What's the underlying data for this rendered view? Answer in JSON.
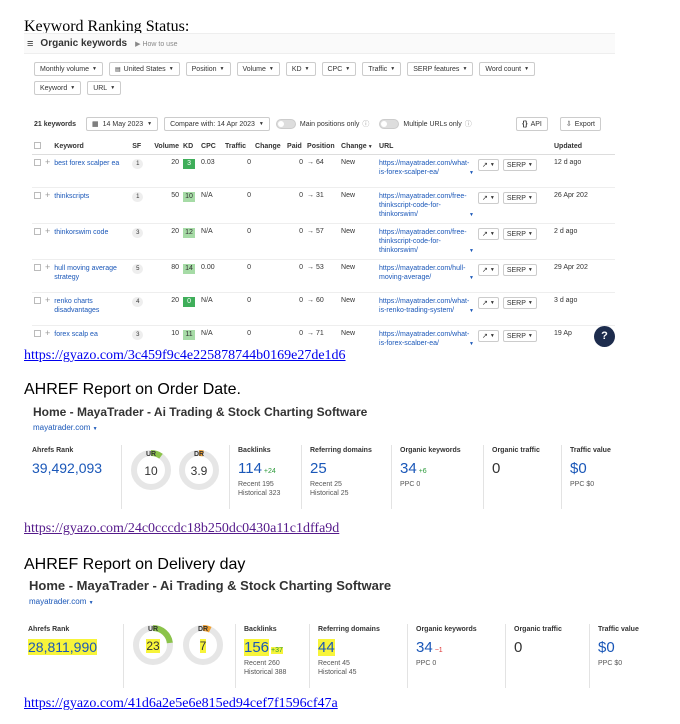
{
  "heading1": "Keyword Ranking Status:",
  "kw_panel": {
    "menu_icon": "hamburger-icon",
    "title": "Organic keywords",
    "howto": "How to use",
    "filters": [
      {
        "label": "Monthly volume",
        "icon": ""
      },
      {
        "label": "United States",
        "icon": "us-flag"
      },
      {
        "label": "Position",
        "icon": ""
      },
      {
        "label": "Volume",
        "icon": ""
      },
      {
        "label": "KD",
        "icon": ""
      },
      {
        "label": "CPC",
        "icon": ""
      },
      {
        "label": "Traffic",
        "icon": ""
      },
      {
        "label": "SERP features",
        "icon": ""
      },
      {
        "label": "Word count",
        "icon": ""
      },
      {
        "label": "Keyword",
        "icon": ""
      },
      {
        "label": "URL",
        "icon": ""
      }
    ],
    "toolbar": {
      "count": "21 keywords",
      "date": "14 May 2023",
      "compare": "Compare with: 14 Apr 2023",
      "main_positions": "Main positions only",
      "multiple_urls": "Multiple URLs only",
      "api": "API",
      "export": "Export"
    },
    "columns": [
      "Keyword",
      "SF",
      "Volume",
      "KD",
      "CPC",
      "Traffic",
      "Change",
      "Paid",
      "Position",
      "Change",
      "URL",
      "",
      "Updated"
    ],
    "rows": [
      {
        "keyword": "best forex scalper ea",
        "sf": "1",
        "volume": "20",
        "kd": "3",
        "kd_color": "#3fae5a",
        "cpc": "0.03",
        "traffic": "0",
        "paid": "0",
        "position": "→ 64",
        "change": "New",
        "url": "https://mayatrader.com/what-is-forex-scalper-ea/",
        "serp": "SERP",
        "updated": "12 d ago"
      },
      {
        "keyword": "thinkscripts",
        "sf": "1",
        "volume": "50",
        "kd": "10",
        "kd_color": "#a6dba6",
        "cpc": "N/A",
        "traffic": "0",
        "paid": "0",
        "position": "→ 31",
        "change": "New",
        "url": "https://mayatrader.com/free-thinkscript-code-for-thinkorswim/",
        "serp": "SERP",
        "updated": "26 Apr 202"
      },
      {
        "keyword": "thinkorswim code",
        "sf": "3",
        "volume": "20",
        "kd": "12",
        "kd_color": "#a6dba6",
        "cpc": "N/A",
        "traffic": "0",
        "paid": "0",
        "position": "→ 57",
        "change": "New",
        "url": "https://mayatrader.com/free-thinkscript-code-for-thinkorswim/",
        "serp": "SERP",
        "updated": "2 d ago"
      },
      {
        "keyword": "hull moving average strategy",
        "sf": "5",
        "volume": "80",
        "kd": "14",
        "kd_color": "#a6dba6",
        "cpc": "0.00",
        "traffic": "0",
        "paid": "0",
        "position": "→ 53",
        "change": "New",
        "url": "https://mayatrader.com/hull-moving-average/",
        "serp": "SERP",
        "updated": "29 Apr 202"
      },
      {
        "keyword": "renko charts disadvantages",
        "sf": "4",
        "volume": "20",
        "kd": "0",
        "kd_color": "#3fae5a",
        "cpc": "N/A",
        "traffic": "0",
        "paid": "0",
        "position": "→ 60",
        "change": "New",
        "url": "https://mayatrader.com/what-is-renko-trading-system/",
        "serp": "SERP",
        "updated": "3 d ago"
      },
      {
        "keyword": "forex scalp ea",
        "sf": "3",
        "volume": "10",
        "kd": "11",
        "kd_color": "#a6dba6",
        "cpc": "N/A",
        "traffic": "0",
        "paid": "0",
        "position": "→ 71",
        "change": "New",
        "url": "https://mayatrader.com/what-is-forex-scalper-ea/",
        "serp": "SERP",
        "updated": "19 Ap"
      }
    ],
    "help": "?"
  },
  "link1": "https://gyazo.com/3c459f9c4e225878744b0169e27de1d6",
  "heading2": "AHREF Report on Order Date.",
  "report1": {
    "title": "Home - MayaTrader - Ai Trading & Stock Charting Software",
    "domain": "mayatrader.com",
    "ahrefs_rank_label": "Ahrefs Rank",
    "ahrefs_rank": "39,492,093",
    "ur_label": "UR",
    "ur": "10",
    "ur_level": 0.1,
    "dr_label": "DR",
    "dr": "3.9",
    "dr_level": 0.04,
    "backlinks_label": "Backlinks",
    "backlinks": "114",
    "backlinks_delta": "+24",
    "backlinks_recent": "Recent 195",
    "backlinks_hist": "Historical 323",
    "refdom_label": "Referring domains",
    "refdom": "25",
    "refdom_recent": "Recent 25",
    "refdom_hist": "Historical 25",
    "organic_kw_label": "Organic keywords",
    "organic_kw": "34",
    "organic_kw_delta": "+6",
    "ppc_kw": "PPC 0",
    "organic_traffic_label": "Organic traffic",
    "organic_traffic": "0",
    "traffic_value_label": "Traffic value",
    "traffic_value": "$0",
    "ppc_value": "PPC $0"
  },
  "link2": "https://gyazo.com/24c0cccdc18b250dc0430a11c1dffa9d",
  "heading3": "AHREF Report on Delivery day",
  "report2": {
    "title": "Home - MayaTrader - Ai Trading & Stock Charting Software",
    "domain": "mayatrader.com",
    "ahrefs_rank_label": "Ahrefs Rank",
    "ahrefs_rank": "28,811,990",
    "ur_label": "UR",
    "ur": "23",
    "ur_level": 0.23,
    "dr_label": "DR",
    "dr": "7",
    "dr_level": 0.07,
    "backlinks_label": "Backlinks",
    "backlinks": "156",
    "backlinks_delta": "+37",
    "backlinks_recent": "Recent 260",
    "backlinks_hist": "Historical 388",
    "refdom_label": "Referring domains",
    "refdom": "44",
    "refdom_recent": "Recent 45",
    "refdom_hist": "Historical 45",
    "organic_kw_label": "Organic keywords",
    "organic_kw": "34",
    "organic_kw_delta": "−1",
    "ppc_kw": "PPC 0",
    "organic_traffic_label": "Organic traffic",
    "organic_traffic": "0",
    "traffic_value_label": "Traffic value",
    "traffic_value": "$0",
    "ppc_value": "PPC $0"
  },
  "link3": "https://gyazo.com/41d6a2e5e6e815ed94cef7f1596cf47a",
  "colors": {
    "link": "#1a57b8",
    "new": "#2b9a3a",
    "highlight": "#f7f43a",
    "gauge_ur": "#8bc34a",
    "gauge_dr": "#f0a030"
  }
}
